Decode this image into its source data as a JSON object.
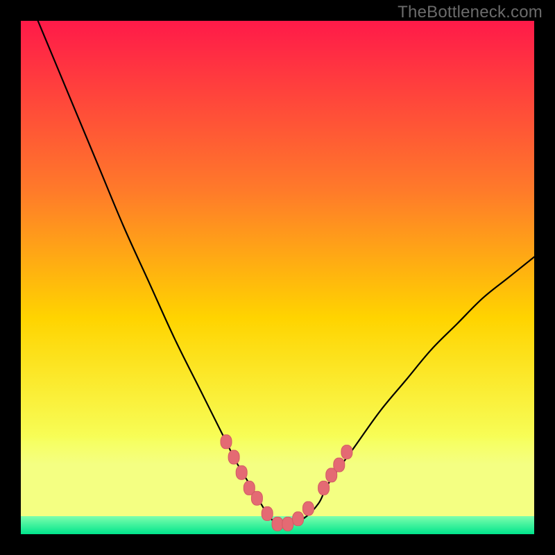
{
  "attribution": "TheBottleneck.com",
  "colors": {
    "frame": "#000000",
    "gradient_top": "#ff1a49",
    "gradient_mid_upper": "#ff7a2a",
    "gradient_mid": "#ffd400",
    "gradient_lower": "#f7ff5a",
    "lemon_band": "#f4ff82",
    "green_top": "#7dffad",
    "green_bottom": "#00e58c",
    "curve": "#000000",
    "marker_fill": "#e46a73",
    "marker_stroke": "#d25a64"
  },
  "chart_data": {
    "type": "line",
    "title": "",
    "xlabel": "",
    "ylabel": "",
    "xlim": [
      0,
      100
    ],
    "ylim": [
      0,
      100
    ],
    "series": [
      {
        "name": "bottleneck-curve",
        "x": [
          0,
          5,
          10,
          15,
          20,
          25,
          30,
          35,
          40,
          42,
          45,
          48,
          50,
          52,
          55,
          58,
          60,
          65,
          70,
          75,
          80,
          85,
          90,
          95,
          100
        ],
        "y": [
          108,
          96,
          84,
          72,
          60,
          49,
          38,
          28,
          18,
          14,
          9,
          4,
          2,
          2,
          3,
          6,
          10,
          17,
          24,
          30,
          36,
          41,
          46,
          50,
          54
        ]
      }
    ],
    "markers": {
      "name": "highlight-points",
      "x": [
        40,
        41.5,
        43,
        44.5,
        46,
        48,
        50,
        52,
        54,
        56,
        59,
        60.5,
        62,
        63.5
      ],
      "y": [
        18,
        15,
        12,
        9,
        7,
        4,
        2,
        2,
        3,
        5,
        9,
        11.5,
        13.5,
        16
      ]
    },
    "bands": [
      {
        "name": "optimal-green",
        "y_from": 0,
        "y_to": 3.5
      },
      {
        "name": "near-optimal-lemon",
        "y_from": 3.5,
        "y_to": 19
      }
    ]
  }
}
